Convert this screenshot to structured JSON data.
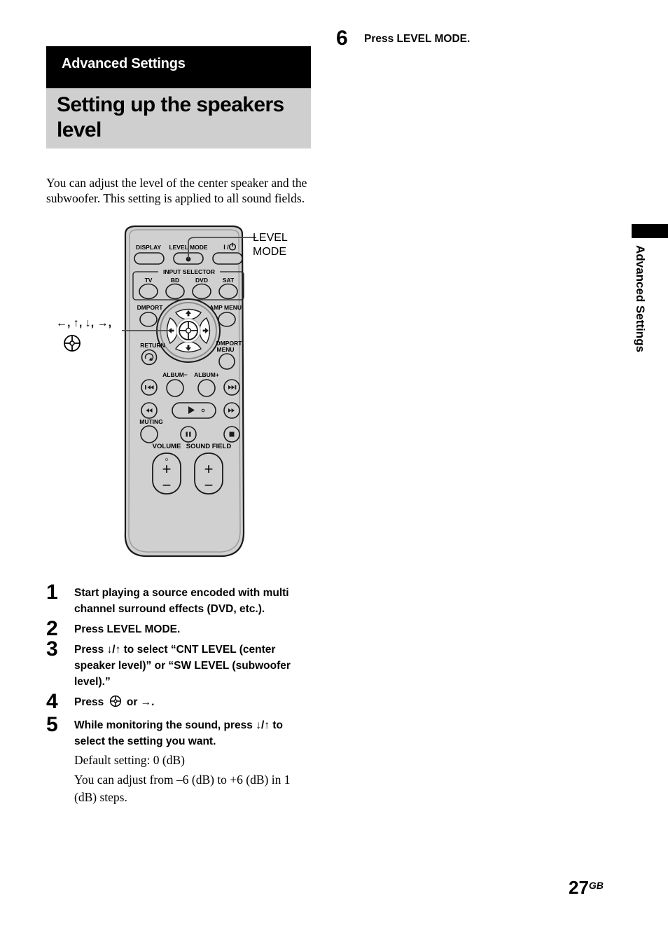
{
  "page": {
    "number": "27",
    "number_suffix": "GB",
    "side_tab_label": "Advanced Settings"
  },
  "section": {
    "bar_label": "Advanced Settings",
    "chapter_title": "Setting up the speakers level",
    "intro": "You can adjust the level of the center speaker and the subwoofer. This setting is applied to all sound fields."
  },
  "figure": {
    "callout_level_mode": "LEVEL\nMODE",
    "callout_arrow_keys": "←, ↑, ↓, →,",
    "enter_icon_name": "enter-button-icon",
    "remote": {
      "buttons": [
        {
          "label": "DISPLAY",
          "name": "display-button"
        },
        {
          "label": "LEVEL MODE",
          "name": "level-mode-button"
        },
        {
          "label": "I / ⏻",
          "name": "power-button"
        },
        {
          "label": "INPUT SELECTOR",
          "name": "input-selector-group"
        },
        {
          "label": "TV",
          "name": "tv-button"
        },
        {
          "label": "BD",
          "name": "bd-button"
        },
        {
          "label": "DVD",
          "name": "dvd-button"
        },
        {
          "label": "SAT",
          "name": "sat-button"
        },
        {
          "label": "DMPORT",
          "name": "dmport-button"
        },
        {
          "label": "AMP MENU",
          "name": "amp-menu-button"
        },
        {
          "label": "RETURN",
          "name": "return-button"
        },
        {
          "label": "DMPORT MENU",
          "name": "dmport-menu-button"
        },
        {
          "label": "ALBUM−",
          "name": "album-minus-button"
        },
        {
          "label": "ALBUM+",
          "name": "album-plus-button"
        },
        {
          "label": "MUTING",
          "name": "muting-button"
        },
        {
          "label": "VOLUME",
          "name": "volume-button"
        },
        {
          "label": "SOUND FIELD",
          "name": "sound-field-button"
        }
      ],
      "labels": {
        "display": "DISPLAY",
        "level_mode": "LEVEL MODE",
        "power": "I /",
        "input_selector": "INPUT SELECTOR",
        "tv": "TV",
        "bd": "BD",
        "dvd": "DVD",
        "sat": "SAT",
        "dmport": "DMPORT",
        "amp_menu": "AMP MENU",
        "return": "RETURN",
        "dmport_menu_line1": "DMPORT",
        "dmport_menu_line2": "MENU",
        "album_minus": "ALBUM−",
        "album_plus": "ALBUM+",
        "muting": "MUTING",
        "volume": "VOLUME",
        "sound_field": "SOUND FIELD",
        "plus": "+",
        "minus": "−"
      }
    }
  },
  "steps": [
    {
      "number": "1",
      "text": "Start playing a source encoded with multi channel surround effects (DVD, etc.)."
    },
    {
      "number": "2",
      "text": "Press LEVEL MODE."
    },
    {
      "number": "3",
      "text": "Press ↓/↑ to select “CNT LEVEL (center speaker level)” or “SW LEVEL (subwoofer level).”"
    },
    {
      "number": "4",
      "text_before": "Press",
      "text_after": "or →."
    },
    {
      "number": "5",
      "text": "While monitoring the sound, press ↓/↑ to select the setting you want.",
      "note_line1": "Default setting: 0 (dB)",
      "note_line2": "You can adjust from –6 (dB) to +6 (dB) in 1 (dB) steps."
    },
    {
      "number": "6",
      "text": "Press LEVEL MODE."
    }
  ],
  "colors": {
    "section_bar": "#000000",
    "chapter_block": "#cfcfcf",
    "remote_body": "#d0d0d0",
    "remote_outline": "#1a1a1a",
    "text": "#000000"
  }
}
